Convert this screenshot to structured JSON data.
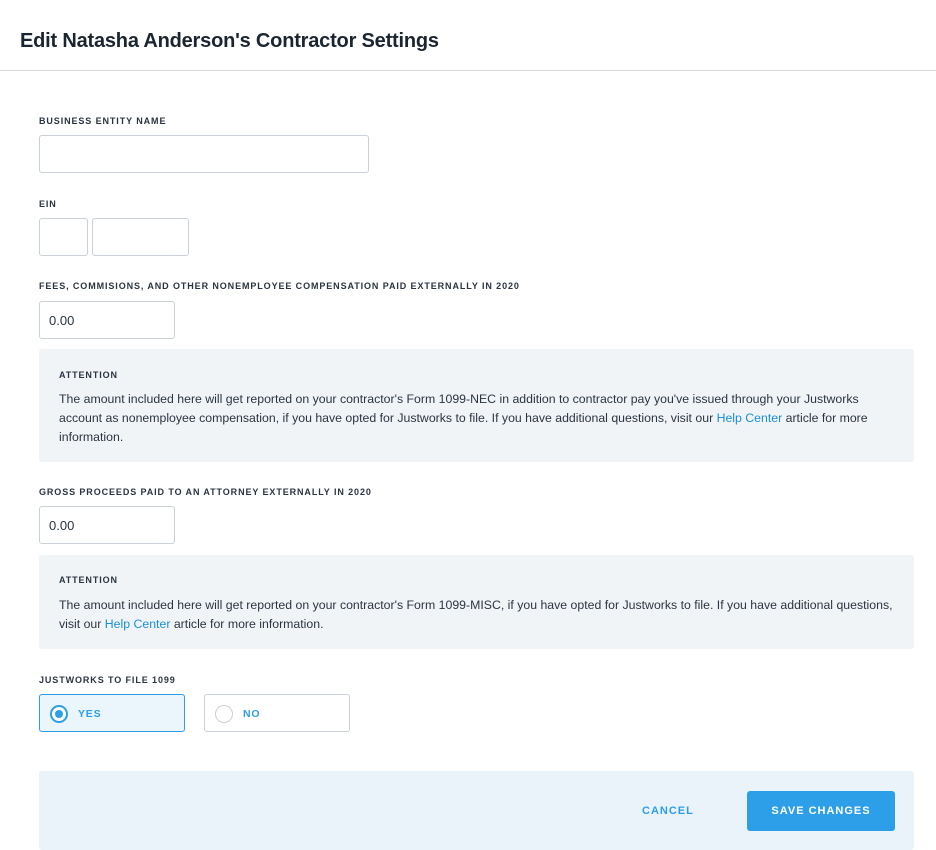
{
  "page": {
    "title": "Edit Natasha Anderson's Contractor Settings"
  },
  "business_entity": {
    "label": "BUSINESS ENTITY NAME",
    "value": ""
  },
  "ein": {
    "label": "EIN",
    "part1": "",
    "part2": ""
  },
  "fees": {
    "label": "FEES, COMMISIONS, AND OTHER NONEMPLOYEE COMPENSATION PAID EXTERNALLY IN 2020",
    "value": "0.00",
    "notice": {
      "title": "ATTENTION",
      "text_before": "The amount included here will get reported on your contractor's Form 1099-NEC in addition to contractor pay you've issued through your Justworks account as nonemployee compensation, if you have opted for Justworks to file. If you have additional questions, visit our ",
      "link": "Help Center",
      "text_after": " article for more information."
    }
  },
  "gross_proceeds": {
    "label": "GROSS PROCEEDS PAID TO AN ATTORNEY EXTERNALLY IN 2020",
    "value": "0.00",
    "notice": {
      "title": "ATTENTION",
      "text_before": "The amount included here will get reported on your contractor's Form 1099-MISC, if you have opted for Justworks to file. If you have additional questions, visit our ",
      "link": "Help Center",
      "text_after": " article for more information."
    }
  },
  "file_1099": {
    "label": "JUSTWORKS TO FILE 1099",
    "options": [
      {
        "label": "YES",
        "selected": true
      },
      {
        "label": "NO",
        "selected": false
      }
    ]
  },
  "footer": {
    "cancel_label": "CANCEL",
    "save_label": "SAVE CHANGES"
  },
  "colors": {
    "accent": "#2d9ee8",
    "link": "#1a8fd8",
    "notice_bg": "#f1f4f7",
    "footer_bg": "#eaf3fa"
  }
}
